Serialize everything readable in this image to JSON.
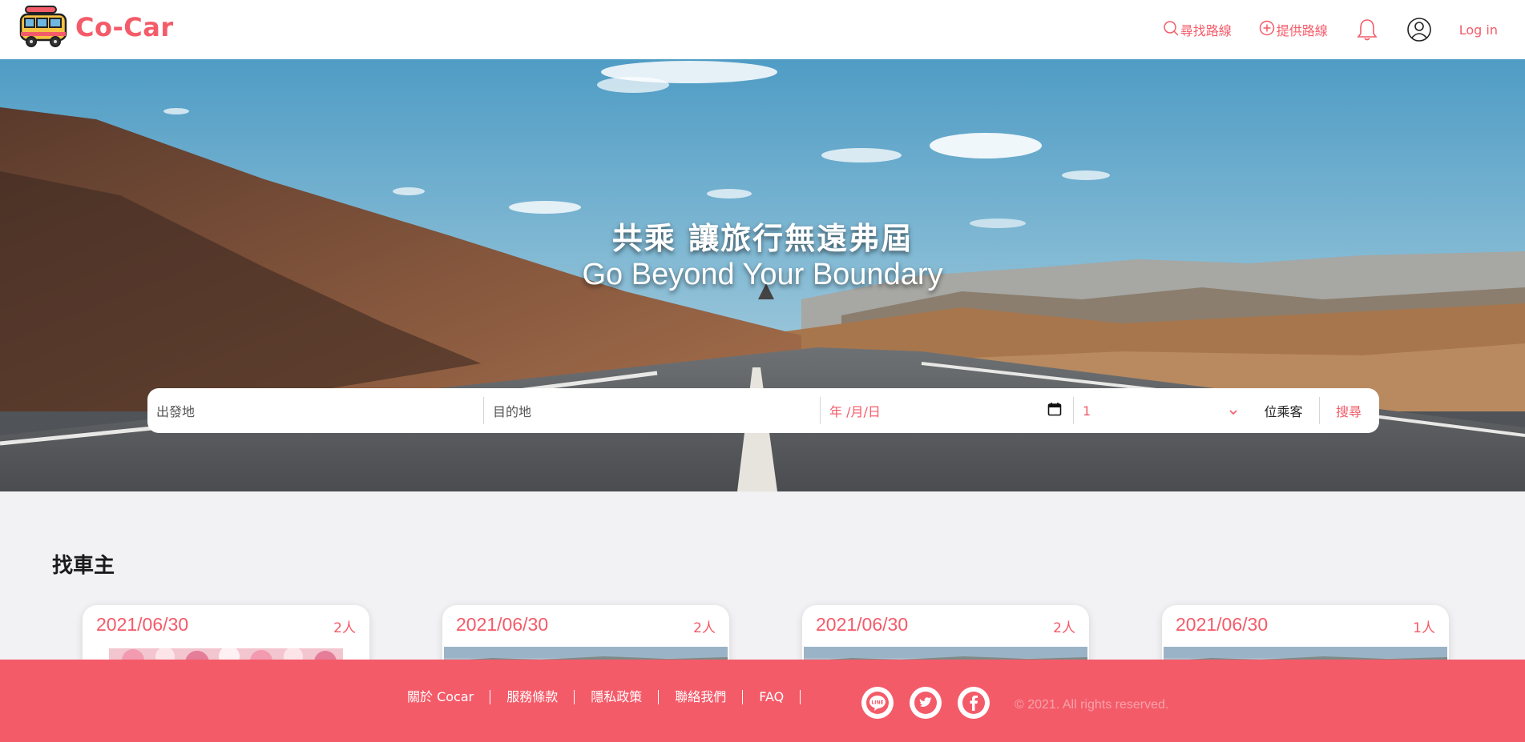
{
  "header": {
    "logo_text": "Co-Car",
    "nav": {
      "find_route": "尋找路線",
      "offer_route": "提供路線",
      "login": "Log in"
    }
  },
  "hero": {
    "title_zh": "共乘 讓旅行無遠弗屆",
    "title_en": "Go Beyond Your Boundary"
  },
  "search": {
    "origin_placeholder": "出發地",
    "destination_placeholder": "目的地",
    "date_placeholder": "年 /月/日",
    "passenger_count": "1",
    "passenger_label": "位乘客",
    "search_button": "搜尋"
  },
  "section": {
    "title": "找車主",
    "cards": [
      {
        "date": "2021/06/30",
        "count": "2人"
      },
      {
        "date": "2021/06/30",
        "count": "2人"
      },
      {
        "date": "2021/06/30",
        "count": "2人"
      },
      {
        "date": "2021/06/30",
        "count": "1人"
      }
    ]
  },
  "footer": {
    "links": [
      "關於 Cocar",
      "服務條款",
      "隱私政策",
      "聯絡我們",
      "FAQ"
    ],
    "social_line": "LINE",
    "copyright": "© 2021. All rights reserved."
  },
  "colors": {
    "accent": "#f45b69",
    "footer_bg": "#f45b69",
    "page_bg": "#f2f1f4"
  },
  "icons": [
    "van-logo-icon",
    "search-icon",
    "plus-circle-icon",
    "bell-icon",
    "user-icon",
    "calendar-icon",
    "chevron-down-icon",
    "line-icon",
    "twitter-icon",
    "facebook-icon"
  ]
}
